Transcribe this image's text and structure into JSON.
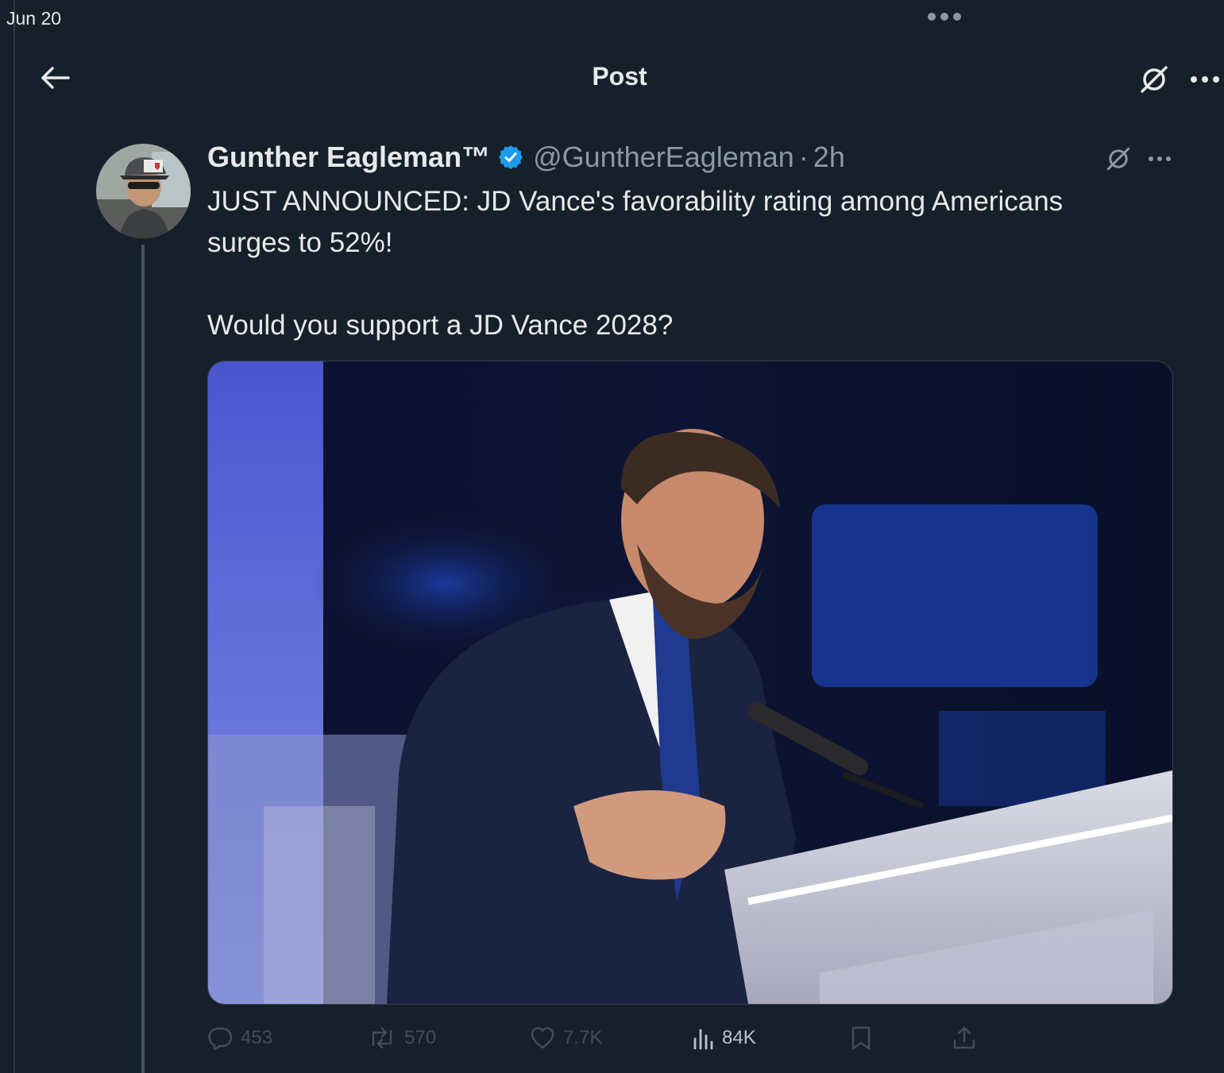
{
  "status_bar": {
    "date": "Jun 20"
  },
  "header": {
    "title": "Post"
  },
  "post": {
    "author_name": "Gunther Eagleman™",
    "handle": "@GuntherEagleman",
    "separator": "·",
    "time": "2h",
    "text_lines": [
      "JUST ANNOUNCED: JD Vance's favorability rating among Americans",
      "surges to 52%!",
      "Would you support a JD Vance 2028?"
    ]
  },
  "actions": {
    "replies": "453",
    "reposts": "570",
    "likes": "7.7K",
    "views": "84K"
  },
  "colors": {
    "background": "#15202b",
    "text": "#e7e9ea",
    "muted": "#8b98a5",
    "verified": "#1d9bf0"
  }
}
